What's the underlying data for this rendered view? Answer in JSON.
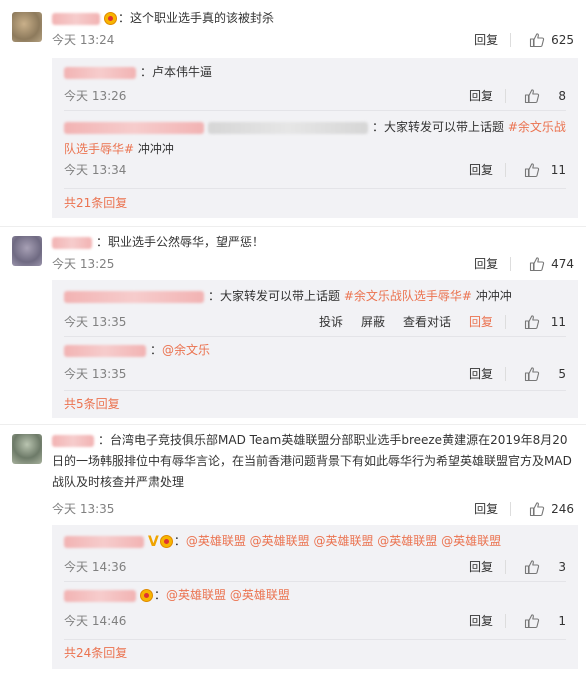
{
  "comments": [
    {
      "text": "：这个职业选手真的该被封杀",
      "time": "今天 13:24",
      "reply": "回复",
      "likes": "625",
      "subs": [
        {
          "text": "：卢本伟牛逼",
          "time": "今天 13:26",
          "reply": "回复",
          "likes": "8"
        },
        {
          "text": "：大家转发可以带上话题 ",
          "tag": "#余文乐战队选手辱华#",
          "text2": " 冲冲冲",
          "time": "今天 13:34",
          "reply": "回复",
          "likes": "11"
        }
      ],
      "more": "共21条回复"
    },
    {
      "text": "：职业选手公然辱华，望严惩！",
      "time": "今天 13:25",
      "reply": "回复",
      "likes": "474",
      "subs": [
        {
          "text": "：大家转发可以带上话题 ",
          "tag": "#余文乐战队选手辱华#",
          "text2": " 冲冲冲",
          "time": "今天 13:35",
          "report": "投诉",
          "block": "屏蔽",
          "view": "查看对话",
          "reply": "回复",
          "likes": "11"
        },
        {
          "text": "：",
          "mention": "@余文乐",
          "time": "今天 13:35",
          "reply": "回复",
          "likes": "5"
        }
      ],
      "more": "共5条回复"
    },
    {
      "text": "：台湾电子竞技俱乐部MAD Team英雄联盟分部职业选手breeze黄建源在2019年8月20日的一场韩服排位中有辱华言论，在当前香港问题背景下有如此辱华行为希望英雄联盟官方及MAD战队及时核查并严肃处理",
      "time": "今天 13:35",
      "reply": "回复",
      "likes": "246",
      "subs": [
        {
          "text": "：",
          "mentions": "@英雄联盟 @英雄联盟 @英雄联盟 @英雄联盟 @英雄联盟",
          "time": "今天 14:36",
          "reply": "回复",
          "likes": "3"
        },
        {
          "text": "：",
          "mentions": "@英雄联盟 @英雄联盟",
          "time": "今天 14:46",
          "reply": "回复",
          "likes": "1"
        }
      ],
      "more": "共24条回复"
    }
  ],
  "colors": {
    "accent": "#eb7350",
    "sub_bg": "#f2f2f5"
  },
  "icons": {
    "like": "thumb-up-icon",
    "member": "vip-crown-icon",
    "verified": "verified-v-icon"
  }
}
